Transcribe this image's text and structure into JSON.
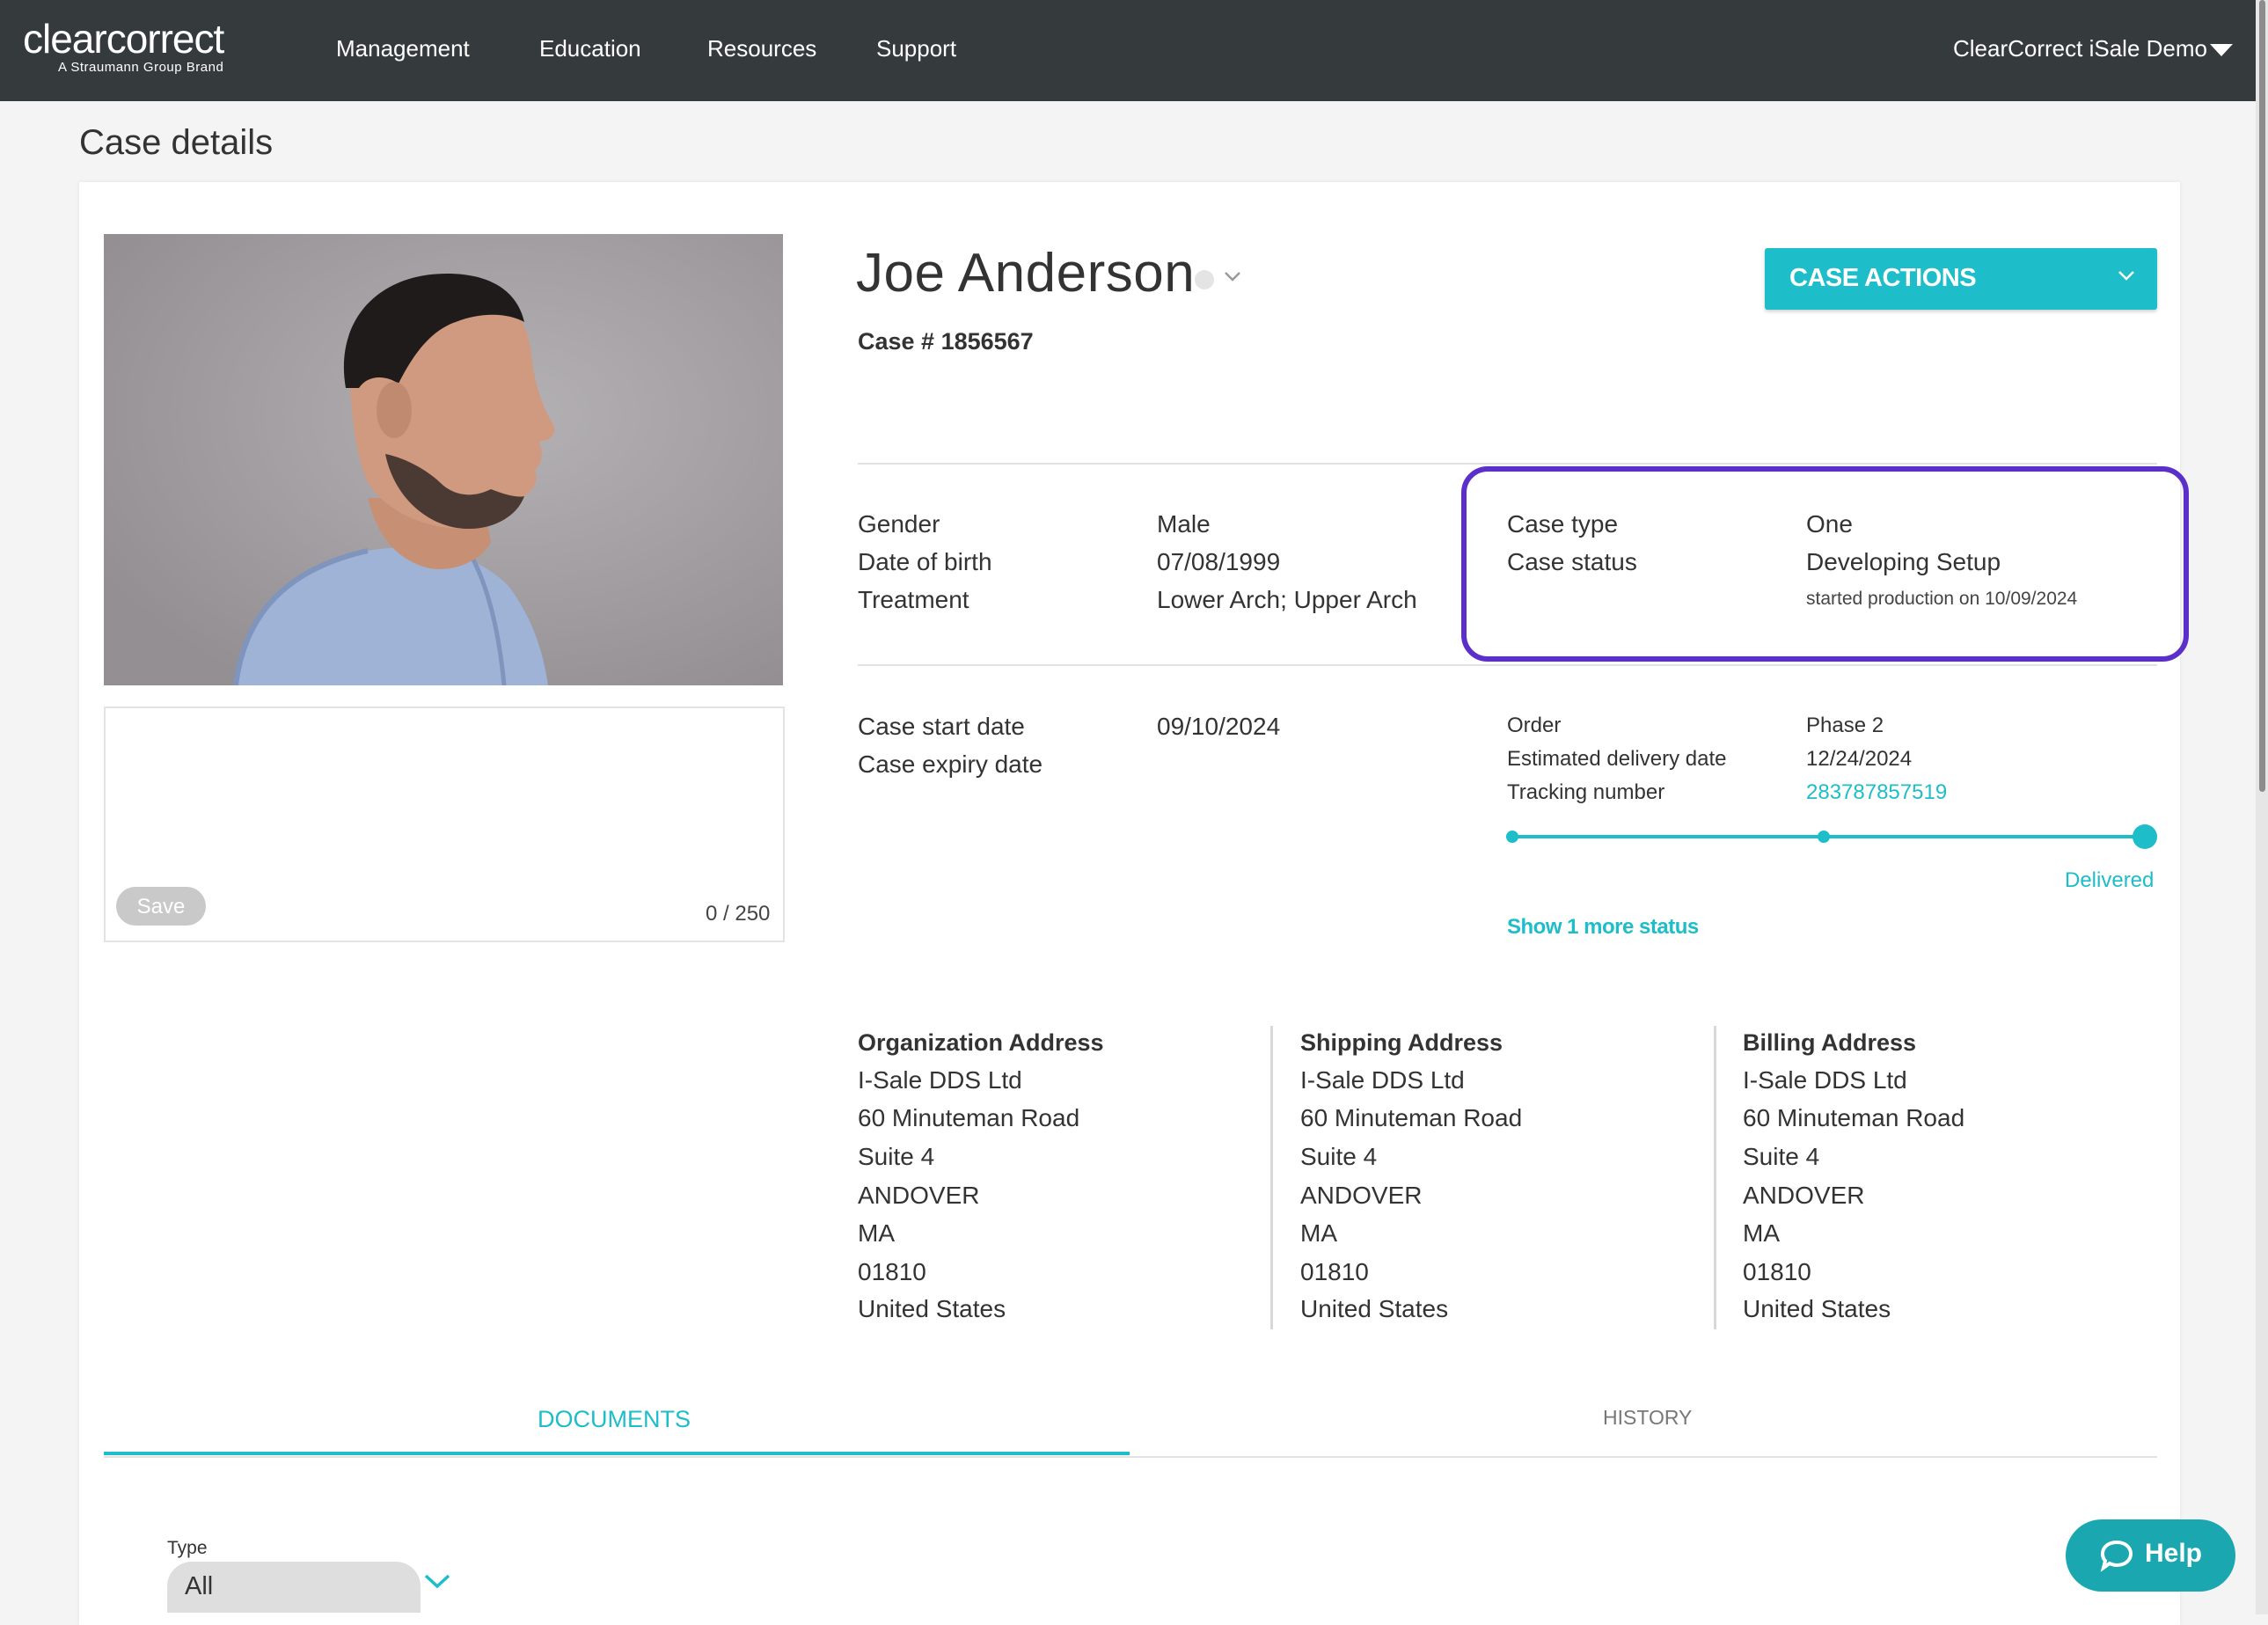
{
  "nav": {
    "logo_main": "clearcorrect",
    "logo_sub": "A Straumann Group Brand",
    "items": [
      "Management",
      "Education",
      "Resources",
      "Support"
    ],
    "user": "ClearCorrect iSale Demo"
  },
  "page": {
    "title": "Case details"
  },
  "notes": {
    "save_label": "Save",
    "counter": "0 / 250"
  },
  "patient": {
    "name": "Joe Anderson",
    "case_number": "Case # 1856567"
  },
  "case_actions": {
    "label": "CASE ACTIONS"
  },
  "info": {
    "gender_label": "Gender",
    "gender_value": "Male",
    "dob_label": "Date of birth",
    "dob_value": "07/08/1999",
    "treatment_label": "Treatment",
    "treatment_value": "Lower Arch; Upper Arch",
    "case_type_label": "Case type",
    "case_type_value": "One",
    "case_status_label": "Case status",
    "case_status_value": "Developing Setup",
    "case_status_note": "started production on 10/09/2024",
    "start_date_label": "Case start date",
    "start_date_value": "09/10/2024",
    "expiry_date_label": "Case expiry date"
  },
  "order": {
    "order_label": "Order",
    "order_value": "Phase 2",
    "delivery_label": "Estimated delivery date",
    "delivery_value": "12/24/2024",
    "tracking_label": "Tracking number",
    "tracking_value": "283787857519",
    "progress_fraction": 1.0,
    "status": "Delivered",
    "more_status": "Show 1 more status"
  },
  "addresses": [
    {
      "title": "Organization Address",
      "lines": [
        "I-Sale DDS Ltd",
        "60 Minuteman Road",
        "Suite 4",
        "ANDOVER",
        "MA",
        "01810",
        "United States"
      ]
    },
    {
      "title": "Shipping Address",
      "lines": [
        "I-Sale DDS Ltd",
        "60 Minuteman Road",
        "Suite 4",
        "ANDOVER",
        "MA",
        "01810",
        "United States"
      ]
    },
    {
      "title": "Billing Address",
      "lines": [
        "I-Sale DDS Ltd",
        "60 Minuteman Road",
        "Suite 4",
        "ANDOVER",
        "MA",
        "01810",
        "United States"
      ]
    }
  ],
  "tabs": {
    "documents": "DOCUMENTS",
    "history": "HISTORY"
  },
  "filter": {
    "type_label": "Type",
    "type_value": "All"
  },
  "help": {
    "label": "Help"
  },
  "colors": {
    "accent": "#1dbdc9",
    "highlight": "#5b2fc9",
    "navbar": "#353a3d"
  }
}
